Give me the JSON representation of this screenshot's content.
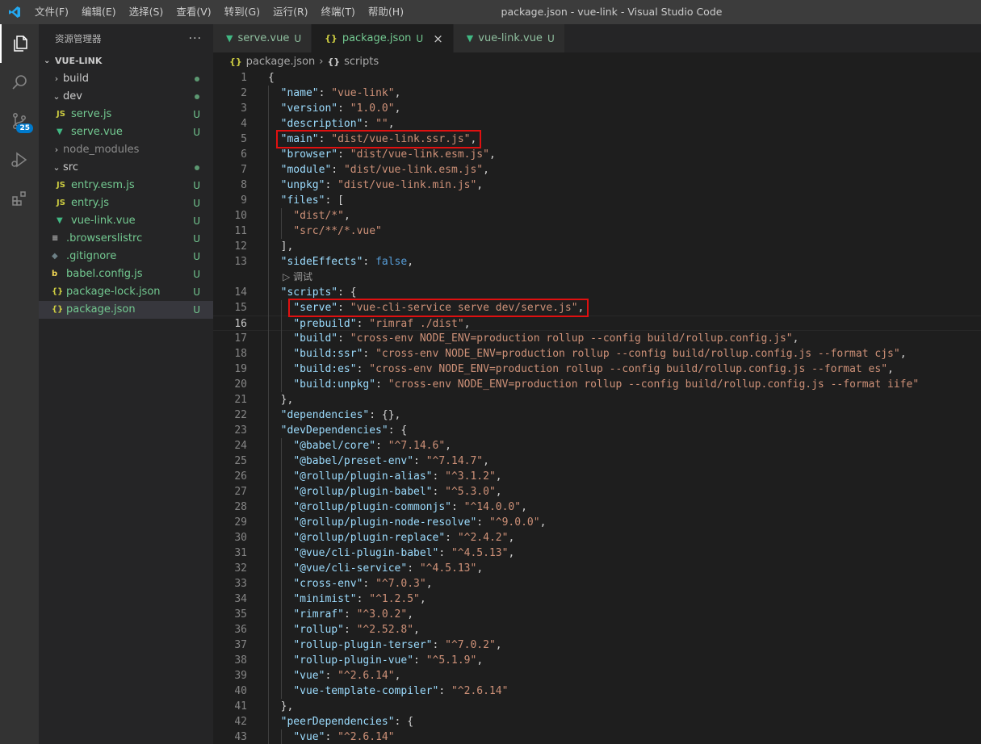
{
  "titlebar": {
    "menu": [
      "文件(F)",
      "编辑(E)",
      "选择(S)",
      "查看(V)",
      "转到(G)",
      "运行(R)",
      "终端(T)",
      "帮助(H)"
    ],
    "window_title": "package.json - vue-link - Visual Studio Code"
  },
  "activity": {
    "scm_badge": "25"
  },
  "sidebar": {
    "title": "资源管理器",
    "more": "···",
    "project": "VUE-LINK",
    "tree": [
      {
        "label": "build",
        "kind": "folder",
        "collapsed": true,
        "depth": 0,
        "status": "dot"
      },
      {
        "label": "dev",
        "kind": "folder",
        "collapsed": false,
        "depth": 0,
        "status": "dot"
      },
      {
        "label": "serve.js",
        "kind": "js",
        "depth": 1,
        "status": "U"
      },
      {
        "label": "serve.vue",
        "kind": "vue",
        "depth": 1,
        "status": "U"
      },
      {
        "label": "node_modules",
        "kind": "folder",
        "collapsed": true,
        "depth": 0,
        "status": ""
      },
      {
        "label": "src",
        "kind": "folder",
        "collapsed": false,
        "depth": 0,
        "status": "dot"
      },
      {
        "label": "entry.esm.js",
        "kind": "js",
        "depth": 1,
        "status": "U"
      },
      {
        "label": "entry.js",
        "kind": "js",
        "depth": 1,
        "status": "U"
      },
      {
        "label": "vue-link.vue",
        "kind": "vue",
        "depth": 1,
        "status": "U"
      },
      {
        "label": ".browserslistrc",
        "kind": "cfg",
        "depth": 0,
        "status": "U"
      },
      {
        "label": ".gitignore",
        "kind": "git",
        "depth": 0,
        "status": "U"
      },
      {
        "label": "babel.config.js",
        "kind": "babel",
        "depth": 0,
        "status": "U"
      },
      {
        "label": "package-lock.json",
        "kind": "json",
        "depth": 0,
        "status": "U"
      },
      {
        "label": "package.json",
        "kind": "json",
        "depth": 0,
        "status": "U",
        "selected": true
      }
    ]
  },
  "tabs": [
    {
      "label": "serve.vue",
      "kind": "vue",
      "status": "U",
      "active": false
    },
    {
      "label": "package.json",
      "kind": "json",
      "status": "U",
      "active": true
    },
    {
      "label": "vue-link.vue",
      "kind": "vue",
      "status": "U",
      "active": false
    }
  ],
  "breadcrumb": [
    "package.json",
    "scripts"
  ],
  "editor": {
    "current_line": 16,
    "codelens": "▷ 调试",
    "lines": [
      [
        1,
        "{"
      ],
      [
        2,
        "  \"name\": \"vue-link\","
      ],
      [
        3,
        "  \"version\": \"1.0.0\","
      ],
      [
        4,
        "  \"description\": \"\","
      ],
      [
        5,
        "  \"main\": \"dist/vue-link.ssr.js\","
      ],
      [
        6,
        "  \"browser\": \"dist/vue-link.esm.js\","
      ],
      [
        7,
        "  \"module\": \"dist/vue-link.esm.js\","
      ],
      [
        8,
        "  \"unpkg\": \"dist/vue-link.min.js\","
      ],
      [
        9,
        "  \"files\": ["
      ],
      [
        10,
        "    \"dist/*\","
      ],
      [
        11,
        "    \"src/**/*.vue\""
      ],
      [
        12,
        "  ],"
      ],
      [
        13,
        "  \"sideEffects\": false,"
      ],
      [
        14,
        "  \"scripts\": {"
      ],
      [
        15,
        "    \"serve\": \"vue-cli-service serve dev/serve.js\","
      ],
      [
        16,
        "    \"prebuild\": \"rimraf ./dist\","
      ],
      [
        17,
        "    \"build\": \"cross-env NODE_ENV=production rollup --config build/rollup.config.js\","
      ],
      [
        18,
        "    \"build:ssr\": \"cross-env NODE_ENV=production rollup --config build/rollup.config.js --format cjs\","
      ],
      [
        19,
        "    \"build:es\": \"cross-env NODE_ENV=production rollup --config build/rollup.config.js --format es\","
      ],
      [
        20,
        "    \"build:unpkg\": \"cross-env NODE_ENV=production rollup --config build/rollup.config.js --format iife\""
      ],
      [
        21,
        "  },"
      ],
      [
        22,
        "  \"dependencies\": {},"
      ],
      [
        23,
        "  \"devDependencies\": {"
      ],
      [
        24,
        "    \"@babel/core\": \"^7.14.6\","
      ],
      [
        25,
        "    \"@babel/preset-env\": \"^7.14.7\","
      ],
      [
        26,
        "    \"@rollup/plugin-alias\": \"^3.1.2\","
      ],
      [
        27,
        "    \"@rollup/plugin-babel\": \"^5.3.0\","
      ],
      [
        28,
        "    \"@rollup/plugin-commonjs\": \"^14.0.0\","
      ],
      [
        29,
        "    \"@rollup/plugin-node-resolve\": \"^9.0.0\","
      ],
      [
        30,
        "    \"@rollup/plugin-replace\": \"^2.4.2\","
      ],
      [
        31,
        "    \"@vue/cli-plugin-babel\": \"^4.5.13\","
      ],
      [
        32,
        "    \"@vue/cli-service\": \"^4.5.13\","
      ],
      [
        33,
        "    \"cross-env\": \"^7.0.3\","
      ],
      [
        34,
        "    \"minimist\": \"^1.2.5\","
      ],
      [
        35,
        "    \"rimraf\": \"^3.0.2\","
      ],
      [
        36,
        "    \"rollup\": \"^2.52.8\","
      ],
      [
        37,
        "    \"rollup-plugin-terser\": \"^7.0.2\","
      ],
      [
        38,
        "    \"rollup-plugin-vue\": \"^5.1.9\","
      ],
      [
        39,
        "    \"vue\": \"^2.6.14\","
      ],
      [
        40,
        "    \"vue-template-compiler\": \"^2.6.14\""
      ],
      [
        41,
        "  },"
      ],
      [
        42,
        "  \"peerDependencies\": {"
      ],
      [
        43,
        "    \"vue\": \"^2.6.14\""
      ]
    ],
    "highlighted_lines": [
      5,
      15
    ]
  },
  "colors": {
    "accent": "#007acc",
    "git_untracked": "#73c991",
    "highlight_box": "#e01010"
  }
}
